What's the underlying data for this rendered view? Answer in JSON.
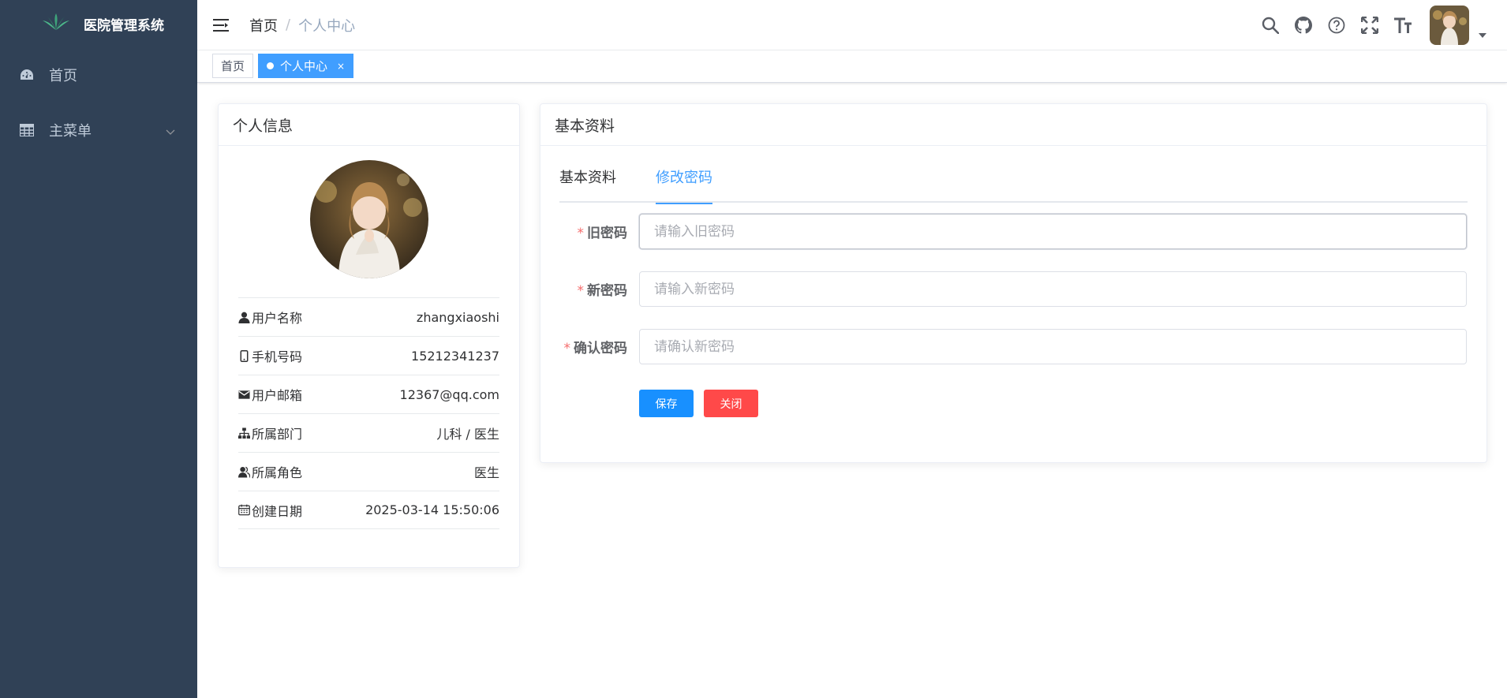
{
  "app": {
    "title": "医院管理系统"
  },
  "sidebar": {
    "items": [
      {
        "label": "首页",
        "icon": "dashboard-icon"
      },
      {
        "label": "主菜单",
        "icon": "table-icon"
      }
    ]
  },
  "navbar": {
    "breadcrumb": {
      "home": "首页",
      "separator": "/",
      "current": "个人中心"
    },
    "icons": [
      "search-icon",
      "github-icon",
      "help-icon",
      "fullscreen-icon",
      "font-size-icon"
    ]
  },
  "tags": {
    "home": "首页",
    "active": "个人中心",
    "close": "×"
  },
  "profile_card": {
    "title": "个人信息",
    "rows": [
      {
        "label": "用户名称",
        "value": "zhangxiaoshi",
        "icon": "user-icon"
      },
      {
        "label": "手机号码",
        "value": "15212341237",
        "icon": "phone-icon"
      },
      {
        "label": "用户邮箱",
        "value": "12367@qq.com",
        "icon": "email-icon"
      },
      {
        "label": "所属部门",
        "value": "儿科 / 医生",
        "icon": "tree-icon"
      },
      {
        "label": "所属角色",
        "value": "医生",
        "icon": "peoples-icon"
      },
      {
        "label": "创建日期",
        "value": "2025-03-14 15:50:06",
        "icon": "date-icon"
      }
    ]
  },
  "settings_card": {
    "title": "基本资料",
    "tabs": [
      "基本资料",
      "修改密码"
    ],
    "active_tab": "修改密码",
    "form": {
      "required_mark": "*",
      "old_password": {
        "label": "旧密码",
        "placeholder": "请输入旧密码",
        "value": ""
      },
      "new_password": {
        "label": "新密码",
        "placeholder": "请输入新密码",
        "value": ""
      },
      "confirm_password": {
        "label": "确认密码",
        "placeholder": "请确认新密码",
        "value": ""
      },
      "save_label": "保存",
      "close_label": "关闭"
    }
  },
  "colors": {
    "sidebar_bg": "#304156",
    "primary": "#1890ff",
    "danger": "#ff4949",
    "tab_active": "#409eff"
  }
}
